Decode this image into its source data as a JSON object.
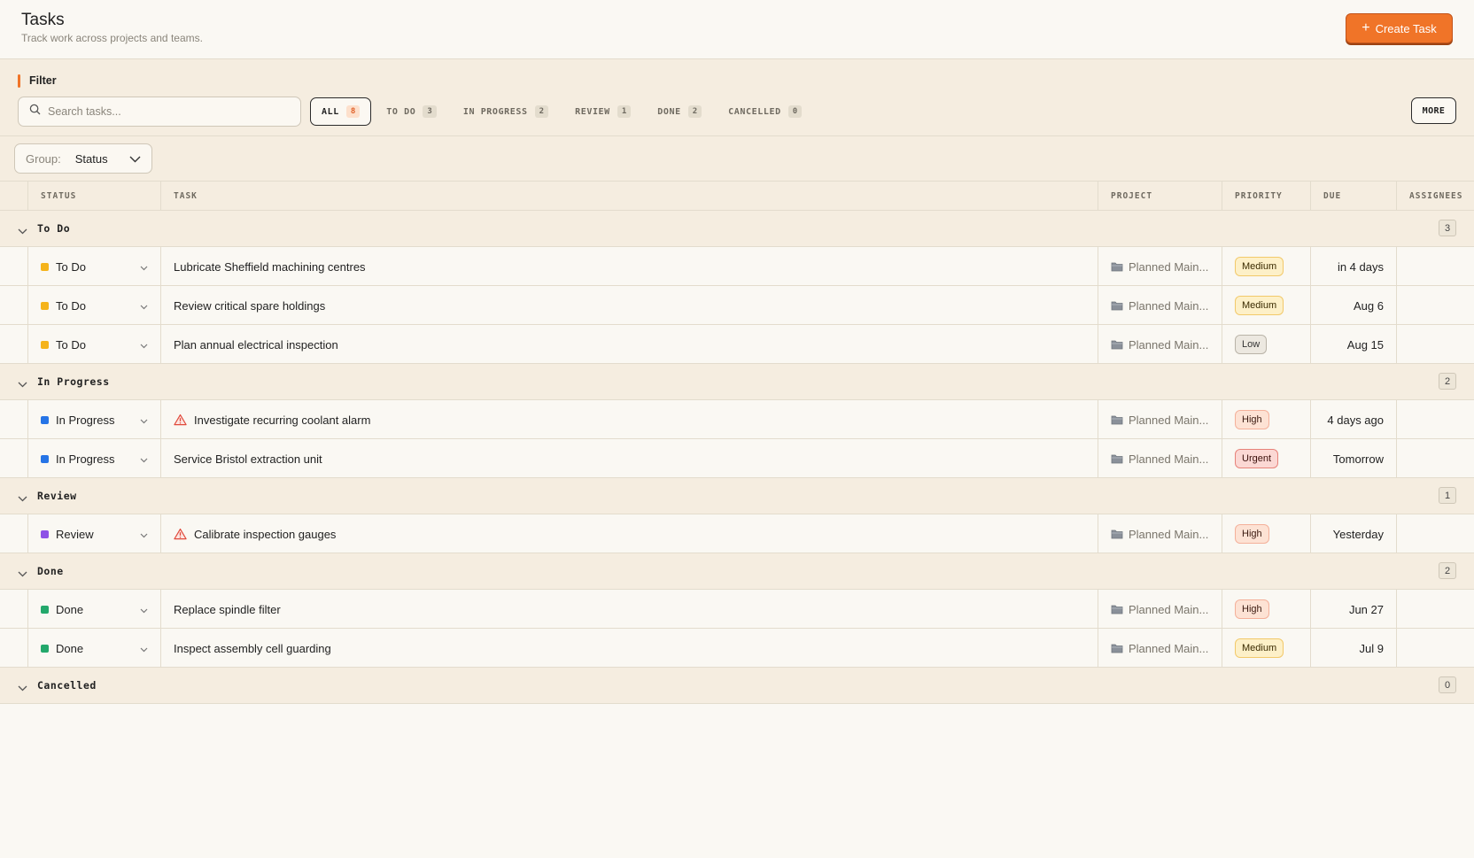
{
  "header": {
    "title": "Tasks",
    "subtitle": "Track work across projects and teams.",
    "create_label": "Create Task"
  },
  "filter": {
    "title": "Filter",
    "search_placeholder": "Search tasks...",
    "tabs": [
      {
        "label": "ALL",
        "count": "8",
        "active": true
      },
      {
        "label": "TO DO",
        "count": "3"
      },
      {
        "label": "IN PROGRESS",
        "count": "2"
      },
      {
        "label": "REVIEW",
        "count": "1"
      },
      {
        "label": "DONE",
        "count": "2"
      },
      {
        "label": "CANCELLED",
        "count": "0"
      }
    ],
    "more_label": "MORE"
  },
  "group": {
    "label": "Group:",
    "value": "Status"
  },
  "columns": {
    "status": "STATUS",
    "task": "TASK",
    "project": "PROJECT",
    "priority": "PRIORITY",
    "due": "DUE",
    "assignees": "ASSIGNEES"
  },
  "colors": {
    "accent": "#f07428",
    "todo": "#f5b31a",
    "in_progress": "#2674e6",
    "review": "#8e52e6",
    "done": "#23a86b",
    "warning": "#e04a3c"
  },
  "groups": [
    {
      "name": "To Do",
      "count": "3",
      "rows": [
        {
          "status": "To Do",
          "status_color": "#f5b31a",
          "task": "Lubricate Sheffield machining centres",
          "warning": false,
          "project": "Planned Main...",
          "priority": "Medium",
          "due": "in 4 days"
        },
        {
          "status": "To Do",
          "status_color": "#f5b31a",
          "task": "Review critical spare holdings",
          "warning": false,
          "project": "Planned Main...",
          "priority": "Medium",
          "due": "Aug 6"
        },
        {
          "status": "To Do",
          "status_color": "#f5b31a",
          "task": "Plan annual electrical inspection",
          "warning": false,
          "project": "Planned Main...",
          "priority": "Low",
          "due": "Aug 15"
        }
      ]
    },
    {
      "name": "In Progress",
      "count": "2",
      "rows": [
        {
          "status": "In Progress",
          "status_color": "#2674e6",
          "task": "Investigate recurring coolant alarm",
          "warning": true,
          "project": "Planned Main...",
          "priority": "High",
          "due": "4 days ago"
        },
        {
          "status": "In Progress",
          "status_color": "#2674e6",
          "task": "Service Bristol extraction unit",
          "warning": false,
          "project": "Planned Main...",
          "priority": "Urgent",
          "due": "Tomorrow"
        }
      ]
    },
    {
      "name": "Review",
      "count": "1",
      "rows": [
        {
          "status": "Review",
          "status_color": "#8e52e6",
          "task": "Calibrate inspection gauges",
          "warning": true,
          "project": "Planned Main...",
          "priority": "High",
          "due": "Yesterday"
        }
      ]
    },
    {
      "name": "Done",
      "count": "2",
      "rows": [
        {
          "status": "Done",
          "status_color": "#23a86b",
          "task": "Replace spindle filter",
          "warning": false,
          "project": "Planned Main...",
          "priority": "High",
          "due": "Jun 27"
        },
        {
          "status": "Done",
          "status_color": "#23a86b",
          "task": "Inspect assembly cell guarding",
          "warning": false,
          "project": "Planned Main...",
          "priority": "Medium",
          "due": "Jul 9"
        }
      ]
    },
    {
      "name": "Cancelled",
      "count": "0",
      "rows": []
    }
  ]
}
